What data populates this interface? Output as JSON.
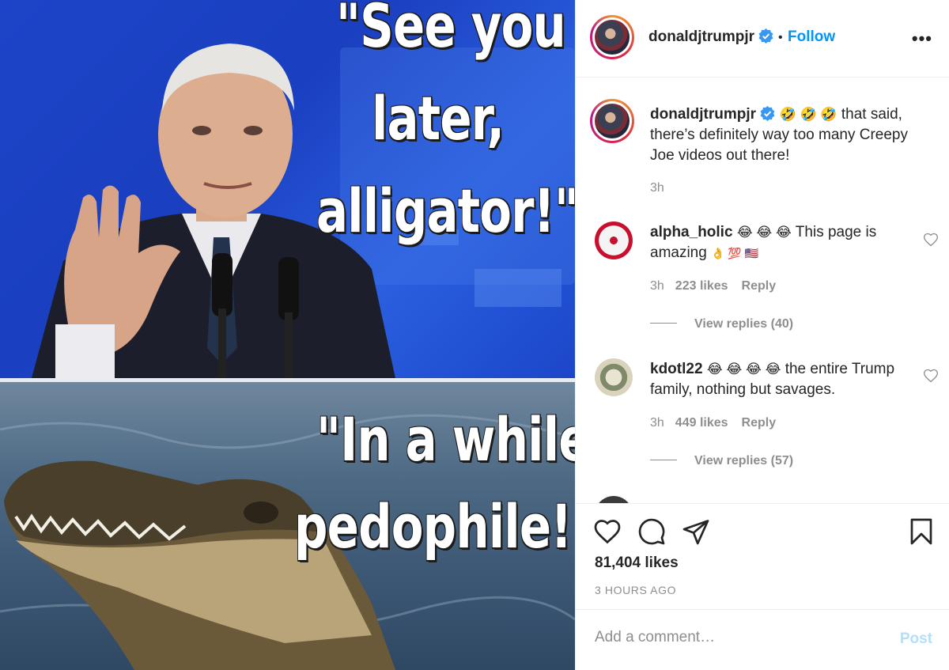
{
  "media": {
    "top_caption_lines": [
      "\"See you",
      "later,",
      "alligator!\""
    ],
    "bottom_caption_lines": [
      "\"In a while,",
      "pedophile!\""
    ]
  },
  "header": {
    "username": "donaldjtrumpjr",
    "separator": "•",
    "follow_label": "Follow",
    "more_icon": "more-options-icon"
  },
  "caption": {
    "username": "donaldjtrumpjr",
    "emojis": "🤣 🤣 🤣",
    "text": " that said, there’s definitely way too many Creepy Joe videos out there!",
    "time": "3h"
  },
  "comments": [
    {
      "username": "alpha_holic",
      "emojis": "😂 😂 😂",
      "text": " This page is amazing ",
      "trailing_emojis": "👌 💯 🇺🇸",
      "time": "3h",
      "likes": "223 likes",
      "reply_label": "Reply",
      "view_replies": "View replies (40)"
    },
    {
      "username": "kdotl22",
      "emojis": "😂 😂 😂 😂",
      "text": " the entire Trump family, nothing but savages.",
      "trailing_emojis": "",
      "time": "3h",
      "likes": "449 likes",
      "reply_label": "Reply",
      "view_replies": "View replies (57)"
    }
  ],
  "actions": {
    "likes": "81,404 likes",
    "time_ago": "3 HOURS AGO"
  },
  "comment_box": {
    "placeholder": "Add a comment…",
    "post_label": "Post"
  },
  "colors": {
    "link_blue": "#0095f6",
    "verified_blue": "#3897f0",
    "muted": "#8e8e8e",
    "post_disabled": "#b2dffc",
    "meme_blue": "#1d44c8"
  }
}
